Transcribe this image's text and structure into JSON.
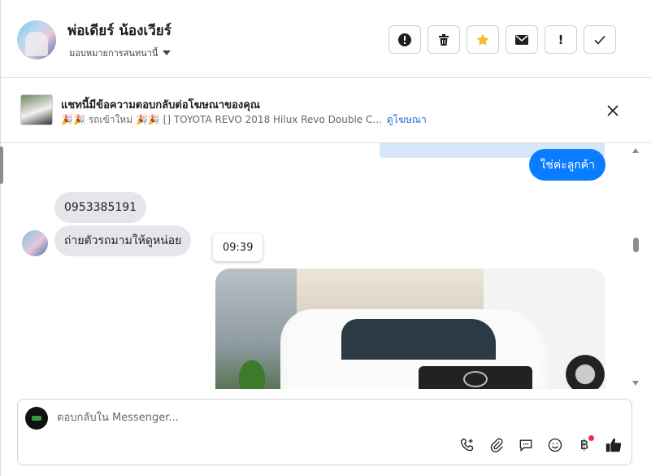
{
  "header": {
    "contact_name": "พ่อเดียร์ น้องเวียร์",
    "assign_label": "มอบหมายการสนทนานี้",
    "actions": [
      {
        "name": "report-spam-button",
        "icon": "alert-circle-icon"
      },
      {
        "name": "delete-button",
        "icon": "trash-icon"
      },
      {
        "name": "star-button",
        "icon": "star-icon",
        "color": "#f7b928"
      },
      {
        "name": "mark-unread-button",
        "icon": "envelope-icon"
      },
      {
        "name": "follow-up-button",
        "icon": "exclamation-icon"
      },
      {
        "name": "mark-done-button",
        "icon": "check-icon"
      }
    ]
  },
  "ad": {
    "title": "แชทนี้มีข้อความตอบกลับต่อโฆษณาของคุณ",
    "description": "🎉🎉 รถเข้าใหม่ 🎉🎉 [] TOYOTA REVO 2018 Hilux Revo Double C...",
    "link_label": "ดูโฆษณา",
    "close_icon": "close-icon"
  },
  "messages": {
    "outgoing_reply": "ใช่ค่ะลูกค้า",
    "incoming_1": "0953385191",
    "incoming_2": "ถ่ายตัวรถมามให้ดูหน่อย",
    "timestamp": "09:39"
  },
  "composer": {
    "placeholder": "ตอบกลับใน Messenger...",
    "tools": [
      "phone-plus-icon",
      "paperclip-icon",
      "chat-bubble-icon",
      "emoji-icon",
      "baht-icon",
      "thumbs-up-icon"
    ]
  },
  "colors": {
    "accent": "#0a7cff",
    "link": "#216fdb",
    "notification_dot": "#f02849",
    "star": "#f7b928"
  }
}
